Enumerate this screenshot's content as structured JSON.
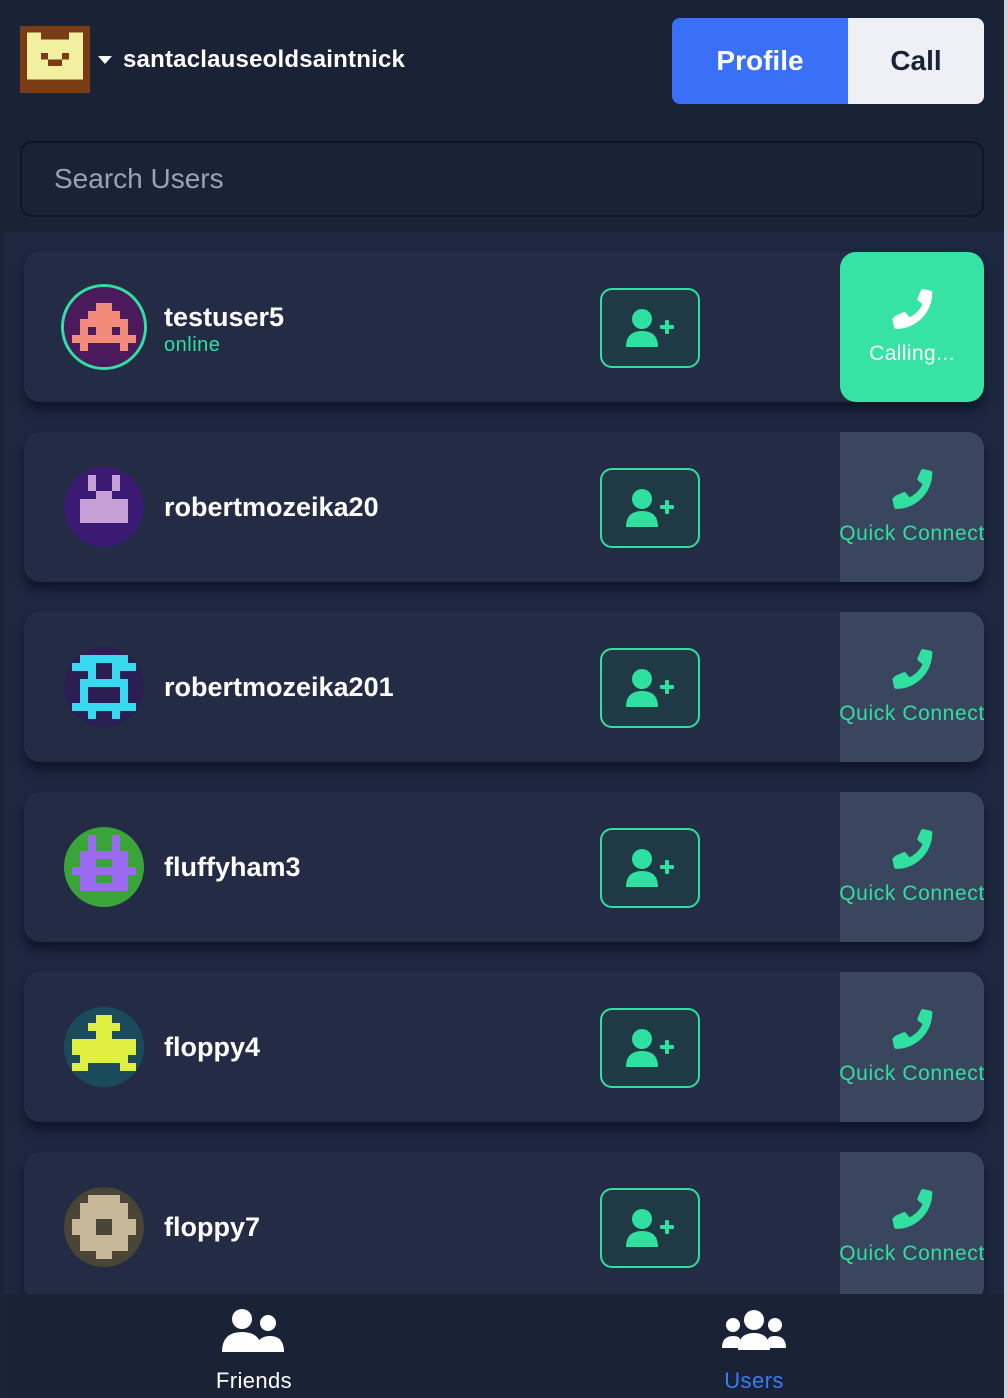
{
  "header": {
    "username": "santaclauseoldsaintnick",
    "profile_label": "Profile",
    "call_label": "Call"
  },
  "search": {
    "placeholder": "Search Users"
  },
  "users": [
    {
      "name": "testuser5",
      "status": "online",
      "action": "Calling..."
    },
    {
      "name": "robertmozeika20",
      "action": "Quick Connect"
    },
    {
      "name": "robertmozeika201",
      "action": "Quick Connect"
    },
    {
      "name": "fluffyham3",
      "action": "Quick Connect"
    },
    {
      "name": "floppy4",
      "action": "Quick Connect"
    },
    {
      "name": "floppy7",
      "action": "Quick Connect"
    }
  ],
  "nav": {
    "friends_label": "Friends",
    "users_label": "Users",
    "active": "Users"
  },
  "colors": {
    "accent_green": "#2fe0a0",
    "profile_blue": "#3a6ff7",
    "active_nav_blue": "#3a7bf7"
  }
}
